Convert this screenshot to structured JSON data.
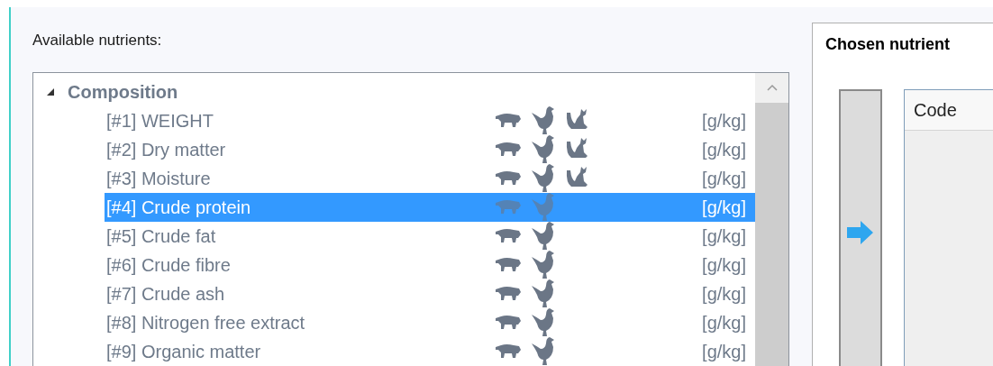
{
  "available_label": "Available nutrients:",
  "tree": {
    "group": "Composition",
    "expanded": true,
    "items": [
      {
        "label": "[#1] WEIGHT",
        "species": [
          {
            "kind": "pig"
          },
          {
            "kind": "chicken"
          },
          {
            "kind": "cat"
          }
        ],
        "unit": "[g/kg]",
        "selected": false
      },
      {
        "label": "[#2] Dry matter",
        "species": [
          {
            "kind": "pig"
          },
          {
            "kind": "chicken"
          },
          {
            "kind": "cat"
          }
        ],
        "unit": "[g/kg]",
        "selected": false
      },
      {
        "label": "[#3] Moisture",
        "species": [
          {
            "kind": "pig"
          },
          {
            "kind": "chicken"
          },
          {
            "kind": "cat"
          }
        ],
        "unit": "[g/kg]",
        "selected": false
      },
      {
        "label": "[#4] Crude protein",
        "species": [
          {
            "kind": "pig"
          },
          {
            "kind": "chicken"
          }
        ],
        "unit": "[g/kg]",
        "selected": true
      },
      {
        "label": "[#5] Crude fat",
        "species": [
          {
            "kind": "pig"
          },
          {
            "kind": "chicken"
          }
        ],
        "unit": "[g/kg]",
        "selected": false
      },
      {
        "label": "[#6] Crude fibre",
        "species": [
          {
            "kind": "pig"
          },
          {
            "kind": "chicken"
          }
        ],
        "unit": "[g/kg]",
        "selected": false
      },
      {
        "label": "[#7] Crude ash",
        "species": [
          {
            "kind": "pig"
          },
          {
            "kind": "chicken"
          }
        ],
        "unit": "[g/kg]",
        "selected": false
      },
      {
        "label": "[#8] Nitrogen free extract",
        "species": [
          {
            "kind": "pig"
          },
          {
            "kind": "chicken"
          }
        ],
        "unit": "[g/kg]",
        "selected": false
      },
      {
        "label": "[#9] Organic matter",
        "species": [
          {
            "kind": "pig"
          },
          {
            "kind": "chicken"
          }
        ],
        "unit": "[g/kg]",
        "selected": false
      }
    ]
  },
  "chosen": {
    "title": "Chosen nutrient",
    "columns": [
      "Code"
    ]
  }
}
